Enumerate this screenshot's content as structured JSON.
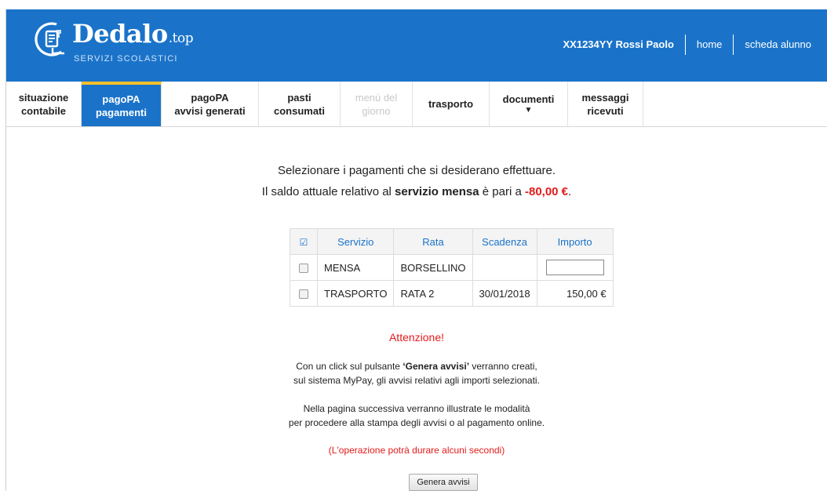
{
  "header": {
    "logo_name": "Dedalo",
    "logo_tld": ".top",
    "logo_subtitle": "SERVIZI SCOLASTICI",
    "user": "XX1234YY Rossi Paolo",
    "links": [
      "home",
      "scheda alunno"
    ],
    "bg_color": "#1a73c9"
  },
  "tabs": [
    {
      "line1": "situazione",
      "line2": "contabile",
      "state": "normal"
    },
    {
      "line1": "pagoPA",
      "line2": "pagamenti",
      "state": "active"
    },
    {
      "line1": "pagoPA",
      "line2": "avvisi generati",
      "state": "normal"
    },
    {
      "line1": "pasti",
      "line2": "consumati",
      "state": "normal"
    },
    {
      "line1": "menù del",
      "line2": "giorno",
      "state": "disabled"
    },
    {
      "line1": "trasporto",
      "line2": "",
      "state": "normal"
    },
    {
      "line1": "documenti",
      "line2": "▼",
      "state": "normal"
    },
    {
      "line1": "messaggi",
      "line2": "ricevuti",
      "state": "normal"
    }
  ],
  "intro": {
    "line1": "Selezionare i pagamenti che si desiderano effettuare.",
    "line2_prefix": "Il saldo attuale relativo al ",
    "line2_service": "servizio mensa",
    "line2_middle": " è pari a ",
    "line2_amount": "-80,00 €",
    "line2_suffix": "."
  },
  "table": {
    "headers": [
      "Servizio",
      "Rata",
      "Scadenza",
      "Importo"
    ],
    "rows": [
      {
        "servizio": "MENSA",
        "rata": "BORSELLINO",
        "scadenza": "",
        "importo": "",
        "editable": true
      },
      {
        "servizio": "TRASPORTO",
        "rata": "RATA 2",
        "scadenza": "30/01/2018",
        "importo": "150,00 €",
        "editable": false
      }
    ]
  },
  "attention": "Attenzione!",
  "info": {
    "p1_prefix": "Con un click sul pulsante ",
    "p1_button": "‘Genera avvisi’",
    "p1_suffix": " verranno creati,",
    "p1_line2": "sul sistema MyPay, gli avvisi relativi agli importi selezionati.",
    "p2_line1": "Nella pagina successiva verranno illustrate le modalità",
    "p2_line2": "per procedere alla stampa degli avvisi o al pagamento online."
  },
  "note": "(L'operazione potrà durare alcuni secondi)",
  "button": "Genera avvisi",
  "colors": {
    "accent": "#1a73c9",
    "active_tab_top": "#f7c02b",
    "negative": "#e41b1b"
  }
}
